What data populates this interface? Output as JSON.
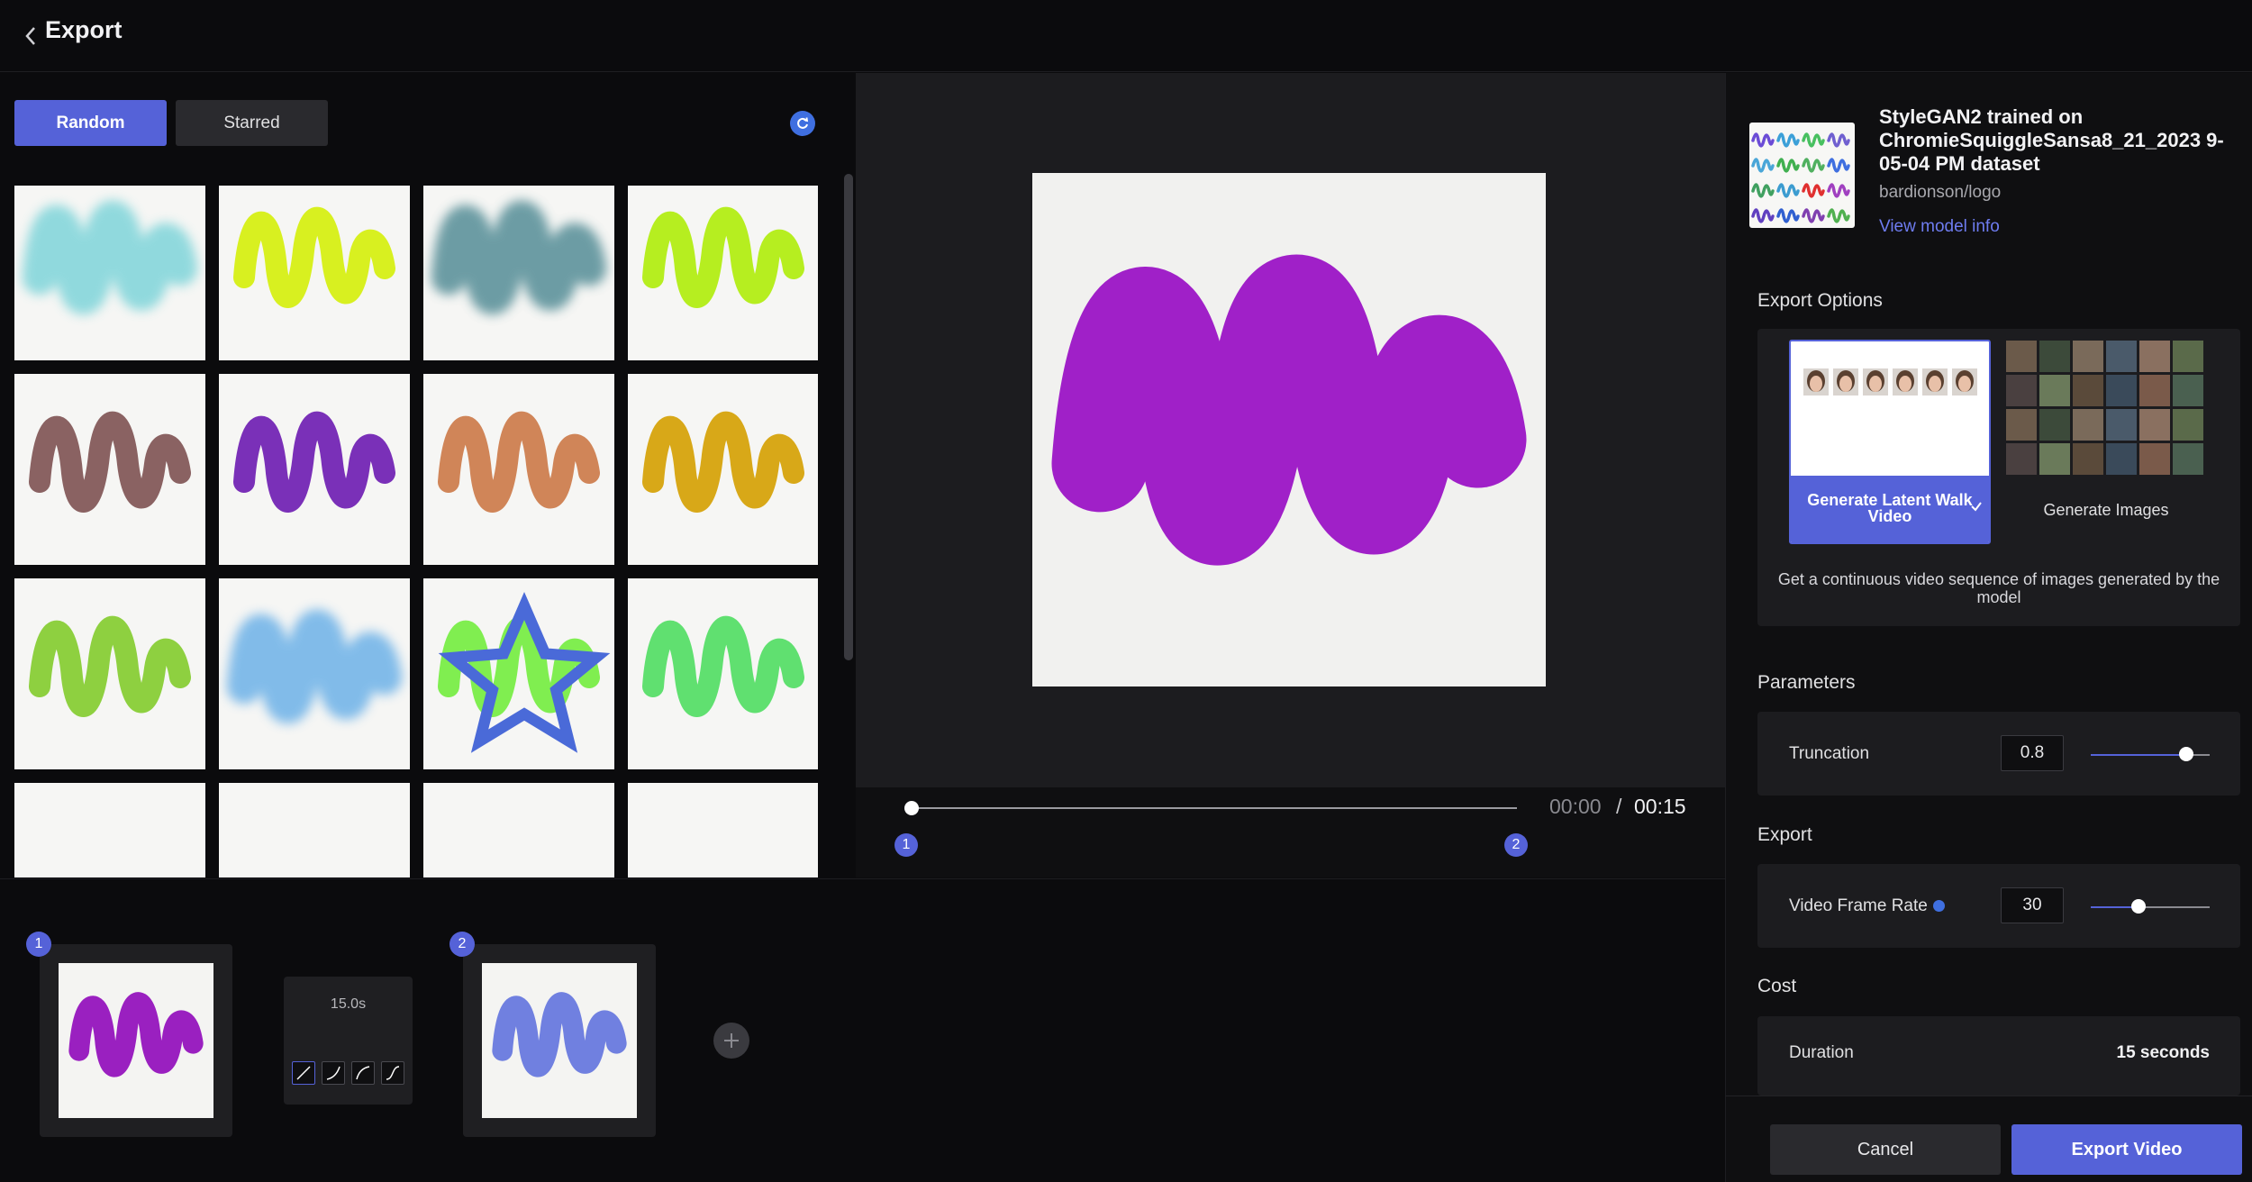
{
  "header": {
    "title": "Export"
  },
  "gallery": {
    "tabs": {
      "random": "Random",
      "starred": "Starred"
    },
    "thumbnails": [
      {
        "color": "#6fd0d6",
        "style": "blur"
      },
      {
        "color": "#d8f020",
        "style": "squiggle"
      },
      {
        "color": "#3f7f8a",
        "style": "blur"
      },
      {
        "color": "#b6ee20",
        "style": "squiggle"
      },
      {
        "color": "#8a6262",
        "style": "squiggle"
      },
      {
        "color": "#7a30b8",
        "style": "squiggle"
      },
      {
        "color": "#d08558",
        "style": "squiggle"
      },
      {
        "color": "#d8a818",
        "style": "squiggle"
      },
      {
        "color": "#8ed040",
        "style": "squiggle"
      },
      {
        "color": "#5aa8e6",
        "style": "blur"
      },
      {
        "color": "#80ee50",
        "style": "squiggle",
        "starred": true
      },
      {
        "color": "#60e070",
        "style": "squiggle"
      },
      {
        "color": "#2050e0",
        "style": "partial"
      },
      {
        "color": "#70c0c0",
        "style": "partial"
      },
      {
        "color": "#80a040",
        "style": "partial"
      },
      {
        "color": "#a0a850",
        "style": "partial"
      }
    ]
  },
  "preview": {
    "color": "#a020c8",
    "time_current": "00:00",
    "time_sep": "/",
    "time_total": "00:15",
    "markers": [
      "1",
      "2"
    ]
  },
  "keyframes": {
    "items": [
      {
        "badge": "1",
        "color": "#9a20c0"
      },
      {
        "badge": "2",
        "color": "#7080e0"
      }
    ],
    "transition_duration": "15.0s"
  },
  "model": {
    "title": "StyleGAN2 trained on ChromieSquiggleSansa8_21_2023 9-05-04 PM dataset",
    "owner": "bardionson/logo",
    "link": "View model info",
    "swatches": [
      "#6b4cd6",
      "#3ca0d8",
      "#48c060",
      "#7060d0",
      "#4aa6d8",
      "#40b050",
      "#50b060",
      "#3f6fe0",
      "#40a060",
      "#3c9cd0",
      "#e03030",
      "#a040c0",
      "#6040c0",
      "#3060d0",
      "#8040b0",
      "#50b050"
    ]
  },
  "export_options": {
    "label": "Export Options",
    "walk_label": "Generate Latent Walk Video",
    "images_label": "Generate Images",
    "description": "Get a continuous video sequence of images generated by the model"
  },
  "parameters": {
    "label": "Parameters",
    "truncation_label": "Truncation",
    "truncation_value": "0.8",
    "truncation_level": 0.8
  },
  "export": {
    "label": "Export",
    "frame_rate_label": "Video Frame Rate",
    "frame_rate_value": "30",
    "frame_rate_level": 0.4
  },
  "cost": {
    "label": "Cost",
    "duration_label": "Duration",
    "duration_value": "15 seconds"
  },
  "footer": {
    "cancel": "Cancel",
    "export": "Export Video"
  }
}
